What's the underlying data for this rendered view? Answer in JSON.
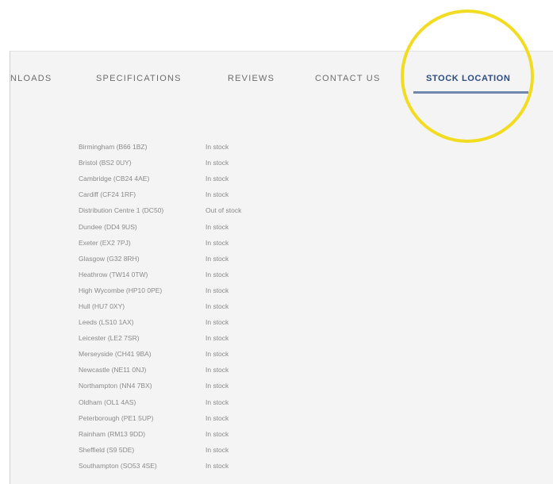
{
  "tabs": [
    {
      "label": "NLOADS",
      "active": false
    },
    {
      "label": "SPECIFICATIONS",
      "active": false
    },
    {
      "label": "REVIEWS",
      "active": false
    },
    {
      "label": "CONTACT US",
      "active": false
    },
    {
      "label": "STOCK LOCATION",
      "active": true
    }
  ],
  "stock": [
    {
      "location": "Birmingham (B66 1BZ)",
      "status": "In stock"
    },
    {
      "location": "Bristol (BS2 0UY)",
      "status": "In stock"
    },
    {
      "location": "Cambridge (CB24 4AE)",
      "status": "In stock"
    },
    {
      "location": "Cardiff (CF24 1RF)",
      "status": "In stock"
    },
    {
      "location": "Distribution Centre 1 (DC50)",
      "status": "Out of stock"
    },
    {
      "location": "Dundee (DD4 9US)",
      "status": "In stock"
    },
    {
      "location": "Exeter (EX2 7PJ)",
      "status": "In stock"
    },
    {
      "location": "Glasgow (G32 8RH)",
      "status": "In stock"
    },
    {
      "location": "Heathrow (TW14 0TW)",
      "status": "In stock"
    },
    {
      "location": "High Wycombe (HP10 0PE)",
      "status": "In stock"
    },
    {
      "location": "Hull (HU7 0XY)",
      "status": "In stock"
    },
    {
      "location": "Leeds (LS10 1AX)",
      "status": "In stock"
    },
    {
      "location": "Leicester (LE2 7SR)",
      "status": "In stock"
    },
    {
      "location": "Merseyside (CH41 9BA)",
      "status": "In stock"
    },
    {
      "location": "Newcastle (NE11 0NJ)",
      "status": "In stock"
    },
    {
      "location": "Northampton (NN4 7BX)",
      "status": "In stock"
    },
    {
      "location": "Oldham (OL1 4AS)",
      "status": "In stock"
    },
    {
      "location": "Peterborough (PE1 5UP)",
      "status": "In stock"
    },
    {
      "location": "Rainham (RM13 9DD)",
      "status": "In stock"
    },
    {
      "location": "Sheffield (S9 5DE)",
      "status": "In stock"
    },
    {
      "location": "Southampton (SO53 4SE)",
      "status": "In stock"
    }
  ],
  "colors": {
    "active_tab": "#2e4c83",
    "active_underline": "#6f86ad",
    "highlight_circle": "#f2dc21"
  }
}
